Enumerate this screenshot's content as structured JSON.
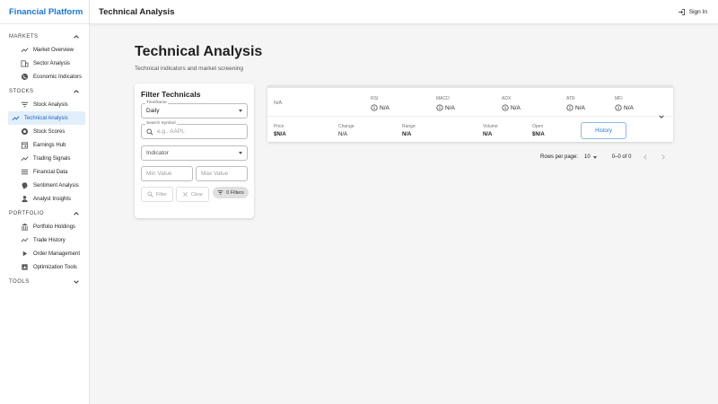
{
  "app": {
    "brand": "Financial Platform"
  },
  "topbar": {
    "title": "Technical Analysis",
    "signin_label": "Sign In"
  },
  "sidebar": {
    "sections": [
      {
        "label": "MARKETS",
        "expanded": true,
        "items": [
          {
            "label": "Market Overview",
            "icon": "trending-up-icon"
          },
          {
            "label": "Sector Analysis",
            "icon": "building-icon"
          },
          {
            "label": "Economic Indicators",
            "icon": "globe-icon"
          }
        ]
      },
      {
        "label": "STOCKS",
        "expanded": true,
        "items": [
          {
            "label": "Stock Analysis",
            "icon": "filter-list-icon"
          },
          {
            "label": "Technical Analysis",
            "icon": "trending-up-icon",
            "active": true
          },
          {
            "label": "Stock Scores",
            "icon": "badge-icon"
          },
          {
            "label": "Earnings Hub",
            "icon": "calendar-icon"
          },
          {
            "label": "Trading Signals",
            "icon": "trending-up-icon"
          },
          {
            "label": "Financial Data",
            "icon": "list-icon"
          },
          {
            "label": "Sentiment Analysis",
            "icon": "psychology-icon"
          },
          {
            "label": "Analyst Insights",
            "icon": "person-icon"
          }
        ]
      },
      {
        "label": "PORTFOLIO",
        "expanded": true,
        "items": [
          {
            "label": "Portfolio Holdings",
            "icon": "bank-icon"
          },
          {
            "label": "Trade History",
            "icon": "timeline-icon"
          },
          {
            "label": "Order Management",
            "icon": "play-icon"
          },
          {
            "label": "Optimization Tools",
            "icon": "assessment-icon"
          }
        ]
      },
      {
        "label": "TOOLS",
        "expanded": false,
        "items": []
      }
    ]
  },
  "main": {
    "title": "Technical Analysis",
    "subtitle": "Technical indicators and market screening"
  },
  "filter": {
    "title": "Filter Technicals",
    "timeframe_label": "Timeframe",
    "timeframe_value": "Daily",
    "symbol_label": "Search Symbol",
    "symbol_placeholder": "e.g., AAPL",
    "indicator_placeholder": "Indicator",
    "min_placeholder": "Min Value",
    "max_placeholder": "Max Value",
    "filter_label": "Filter",
    "clear_label": "Clear",
    "filters_chip": "0 Filters"
  },
  "result": {
    "symbol": "N/A",
    "indicators": [
      {
        "label": "RSI",
        "value": "N/A"
      },
      {
        "label": "MACD",
        "value": "N/A"
      },
      {
        "label": "ADX",
        "value": "N/A"
      },
      {
        "label": "ATR",
        "value": "N/A"
      },
      {
        "label": "MFI",
        "value": "N/A"
      }
    ],
    "stats": [
      {
        "label": "Price",
        "value": "$N/A"
      },
      {
        "label": "Change",
        "value": "N/A"
      },
      {
        "label": "Range",
        "value": "N/A"
      },
      {
        "label": "Volume",
        "value": "N/A"
      },
      {
        "label": "Open",
        "value": "$N/A"
      }
    ],
    "history_label": "History"
  },
  "pagination": {
    "rows_label": "Rows per page:",
    "rows_value": "10",
    "range": "0–0 of 0"
  }
}
